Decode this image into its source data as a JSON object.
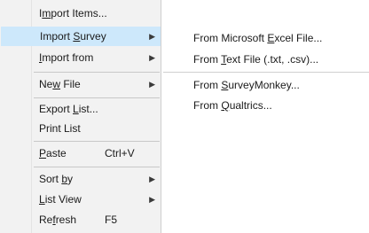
{
  "menu": {
    "items": [
      {
        "pre": "I",
        "ul": "m",
        "post": "port Items...",
        "shortcut": "",
        "submenu": false
      },
      {
        "pre": "Import ",
        "ul": "S",
        "post": "urvey",
        "shortcut": "",
        "submenu": true,
        "highlighted": true
      },
      {
        "pre": "",
        "ul": "I",
        "post": "mport from",
        "shortcut": "",
        "submenu": true
      },
      {
        "pre": "Ne",
        "ul": "w",
        "post": " File",
        "shortcut": "",
        "submenu": true
      },
      {
        "pre": "Export ",
        "ul": "L",
        "post": "ist...",
        "shortcut": "",
        "submenu": false
      },
      {
        "pre": "Print List",
        "ul": "",
        "post": "",
        "shortcut": "",
        "submenu": false
      },
      {
        "pre": "",
        "ul": "P",
        "post": "aste",
        "shortcut": "Ctrl+V",
        "submenu": false
      },
      {
        "pre": "Sort ",
        "ul": "b",
        "post": "y",
        "shortcut": "",
        "submenu": true
      },
      {
        "pre": "",
        "ul": "L",
        "post": "ist View",
        "shortcut": "",
        "submenu": true
      },
      {
        "pre": "Re",
        "ul": "f",
        "post": "resh",
        "shortcut": "F5",
        "submenu": false
      }
    ],
    "arrow_glyph": "▶"
  },
  "submenu": {
    "items": [
      {
        "pre": "From Microsoft ",
        "ul": "E",
        "post": "xcel File..."
      },
      {
        "pre": "From ",
        "ul": "T",
        "post": "ext File (.txt, .csv)..."
      },
      {
        "pre": "From ",
        "ul": "S",
        "post": "urveyMonkey..."
      },
      {
        "pre": "From ",
        "ul": "Q",
        "post": "ualtrics..."
      }
    ]
  },
  "colors": {
    "menu_bg": "#f2f2f2",
    "highlight": "#cde8fb",
    "separator": "#c8c8c8",
    "text": "#1a1a1a"
  }
}
